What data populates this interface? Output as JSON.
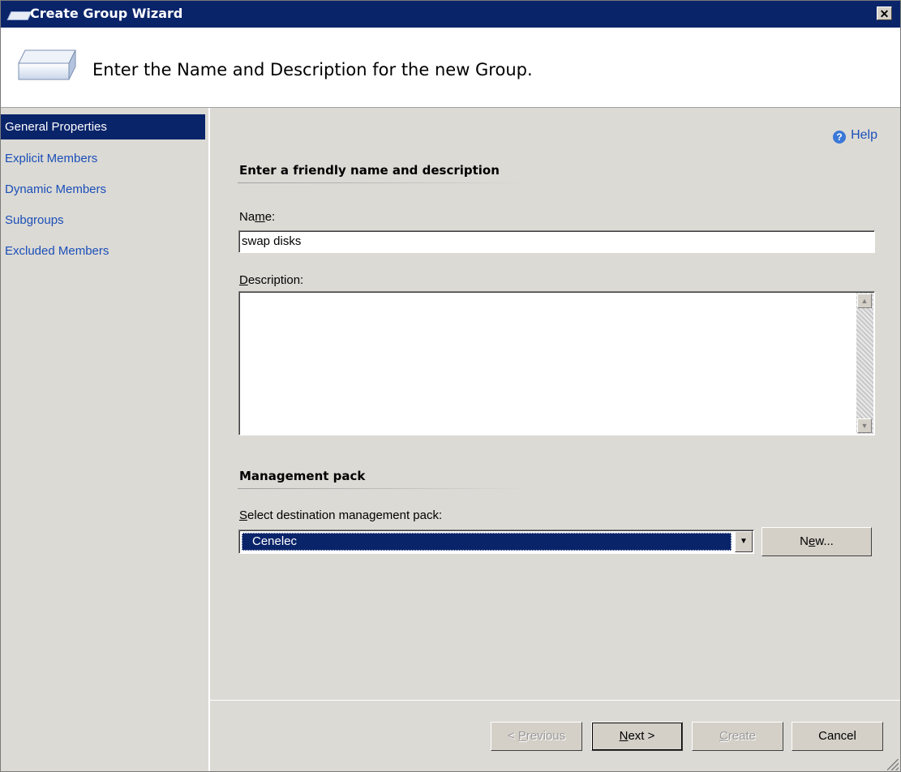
{
  "window": {
    "title": "Create Group Wizard",
    "close_glyph": "✕"
  },
  "header": {
    "text": "Enter the Name and Description for the new Group."
  },
  "nav": {
    "items": [
      {
        "label": "General Properties",
        "active": true
      },
      {
        "label": "Explicit Members"
      },
      {
        "label": "Dynamic Members"
      },
      {
        "label": "Subgroups"
      },
      {
        "label": "Excluded Members"
      }
    ]
  },
  "content": {
    "help_label": "Help",
    "section1_heading": "Enter a friendly name and description",
    "name_label_pre": "Na",
    "name_label_key": "m",
    "name_label_post": "e:",
    "name_value": "swap disks",
    "description_label_key": "D",
    "description_label_post": "escription:",
    "description_value": "",
    "section2_heading": "Management pack",
    "mp_label_key": "S",
    "mp_label_post": "elect destination management pack:",
    "mp_selected": "Cenelec",
    "new_button_pre": "N",
    "new_button_key": "e",
    "new_button_post": "w..."
  },
  "footer": {
    "previous_pre": "< ",
    "previous_key": "P",
    "previous_post": "revious",
    "next_key": "N",
    "next_post": "ext >",
    "create_key": "C",
    "create_post": "reate",
    "cancel": "Cancel"
  },
  "colors": {
    "title_bar": "#0a246a",
    "link": "#1a4fb8",
    "selected": "#0a246a",
    "background": "#dcdad5"
  }
}
